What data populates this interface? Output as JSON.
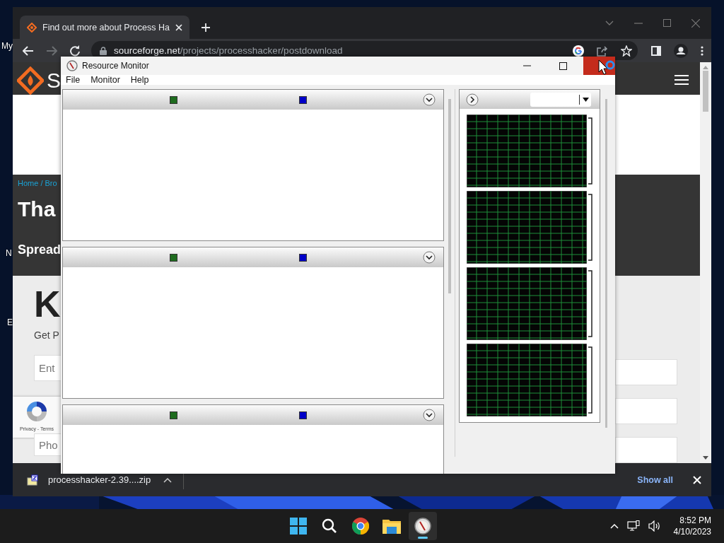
{
  "desktop": {
    "icon_labels": [
      "My",
      "N",
      "E"
    ]
  },
  "browser": {
    "tabs": [
      {
        "title": "Find out more about Process Ha",
        "selected": true
      }
    ],
    "address": {
      "domain": "sourceforge.net",
      "path": "/projects/processhacker/postdownload"
    },
    "page": {
      "logo_text": "S",
      "breadcrumb": "Home / Bro",
      "heading": "Tha",
      "subheading": "Spread",
      "section_heading": "K",
      "section_text": "Get P",
      "email_placeholder": "Ent",
      "phone_placeholder": "Pho",
      "recaptcha_links": "Privacy - Terms"
    },
    "downloads": {
      "file_name": "processhacker-2.39....zip",
      "show_all": "Show all"
    }
  },
  "resource_monitor": {
    "title": "Resource Monitor",
    "menu": [
      "File",
      "Monitor",
      "Help"
    ],
    "panels": [
      {
        "expanded": true,
        "legend": [
          {
            "color": "#1e6b1e"
          },
          {
            "color": "#0000c8"
          }
        ]
      },
      {
        "expanded": true,
        "legend": [
          {
            "color": "#1e6b1e"
          },
          {
            "color": "#0000c8"
          }
        ]
      },
      {
        "expanded": true,
        "legend": [
          {
            "color": "#1e6b1e"
          },
          {
            "color": "#0000c8"
          }
        ]
      }
    ],
    "graphs": [
      {
        "kind": "grid"
      },
      {
        "kind": "grid"
      },
      {
        "kind": "grid"
      },
      {
        "kind": "grid"
      }
    ]
  },
  "taskbar": {
    "apps": [
      {
        "kind": "start",
        "selected": false
      },
      {
        "kind": "search",
        "selected": false
      },
      {
        "kind": "chrome",
        "selected": false
      },
      {
        "kind": "explorer",
        "selected": false
      },
      {
        "kind": "gauge",
        "selected": true
      }
    ],
    "time": "8:52 PM",
    "date": "4/10/2023"
  }
}
